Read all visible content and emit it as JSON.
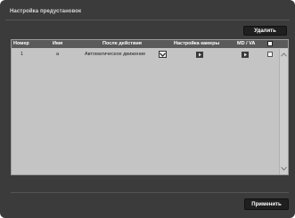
{
  "panel": {
    "title": "Настройка предустановок"
  },
  "toolbar": {
    "delete_label": "Удалить",
    "apply_label": "Применить"
  },
  "table": {
    "headers": {
      "number": "Номер",
      "name": "Имя",
      "after_action": "После действия",
      "camera_setup": "Настройка камеры",
      "md_va": "MD / VA"
    },
    "rows": [
      {
        "number": "1",
        "name": "a",
        "after_action": "Автоматическое движение",
        "checked": false
      }
    ]
  },
  "colors": {
    "panel_bg": "#3b3b3b",
    "table_bg": "#c4c4c4",
    "header_bg": "#5a5a5a",
    "button_bg": "#1f1f1f"
  },
  "icons": {
    "dropdown": "chevron-down-icon",
    "row_action": "chevron-right-icon",
    "scroll_up": "chevron-up-icon",
    "scroll_down": "chevron-down-icon"
  }
}
